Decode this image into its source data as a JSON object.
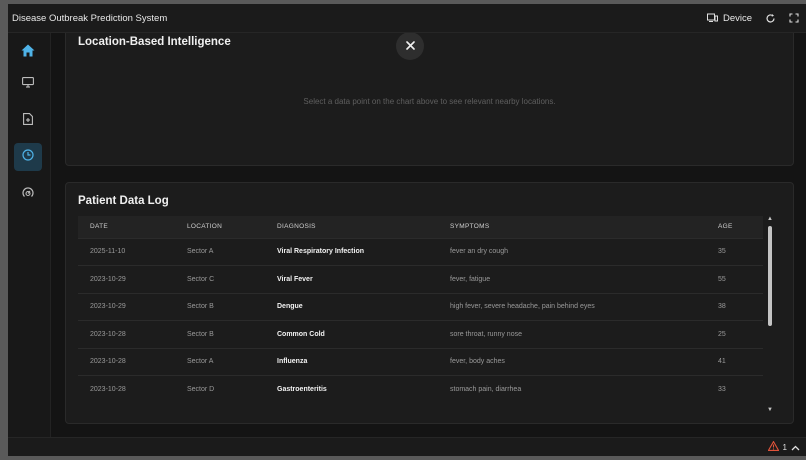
{
  "app": {
    "title": "Disease Outbreak Prediction System",
    "device_label": "Device"
  },
  "sidebar": {
    "items": [
      {
        "name": "home",
        "icon": "home-icon",
        "active": false
      },
      {
        "name": "monitor",
        "icon": "monitor-icon",
        "active": false
      },
      {
        "name": "report",
        "icon": "document-plus-icon",
        "active": false
      },
      {
        "name": "history",
        "icon": "clock-icon",
        "active": true
      },
      {
        "name": "analytics",
        "icon": "gauge-icon",
        "active": false
      }
    ]
  },
  "location_card": {
    "title": "Location-Based Intelligence",
    "placeholder": "Select a data point on the chart above to see relevant nearby locations."
  },
  "patient_log": {
    "title": "Patient Data Log",
    "columns": [
      "DATE",
      "LOCATION",
      "DIAGNOSIS",
      "SYMPTOMS",
      "AGE"
    ],
    "rows": [
      [
        "2025-11-10",
        "Sector A",
        "Viral Respiratory Infection",
        "fever an dry cough",
        "35"
      ],
      [
        "2023-10-29",
        "Sector C",
        "Viral Fever",
        "fever, fatigue",
        "55"
      ],
      [
        "2023-10-29",
        "Sector B",
        "Dengue",
        "high fever, severe headache, pain behind eyes",
        "38"
      ],
      [
        "2023-10-28",
        "Sector B",
        "Common Cold",
        "sore throat, runny nose",
        "25"
      ],
      [
        "2023-10-28",
        "Sector A",
        "Influenza",
        "fever, body aches",
        "41"
      ],
      [
        "2023-10-28",
        "Sector D",
        "Gastroenteritis",
        "stomach pain, diarrhea",
        "33"
      ]
    ]
  },
  "status": {
    "warning_count": "1"
  },
  "colors": {
    "accent": "#4fb3e8",
    "warning": "#e0533a"
  }
}
